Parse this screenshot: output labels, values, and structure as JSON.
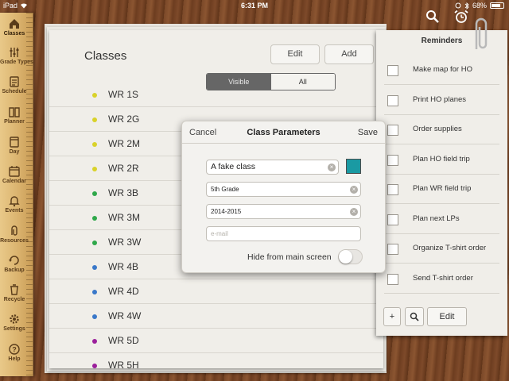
{
  "status_bar": {
    "device": "iPad",
    "time": "6:31 PM",
    "battery": "68%"
  },
  "nav": [
    {
      "label": "Classes",
      "icon": "home-icon"
    },
    {
      "label": "Grade Types",
      "icon": "sliders-icon"
    },
    {
      "label": "Schedule",
      "icon": "schedule-icon"
    },
    {
      "label": "Planner",
      "icon": "book-icon"
    },
    {
      "label": "Day",
      "icon": "day-icon"
    },
    {
      "label": "Calendar",
      "icon": "calendar-icon"
    },
    {
      "label": "Events",
      "icon": "bell-icon"
    },
    {
      "label": "Resources",
      "icon": "paperclip-icon"
    },
    {
      "label": "Backup",
      "icon": "backup-icon"
    },
    {
      "label": "Recycle",
      "icon": "trash-icon"
    },
    {
      "label": "Settings",
      "icon": "gear-icon"
    },
    {
      "label": "Help",
      "icon": "help-icon"
    }
  ],
  "classes_page": {
    "title": "Classes",
    "edit_label": "Edit",
    "add_label": "Add",
    "segment": [
      "Visible",
      "All"
    ],
    "rows": [
      {
        "name": "WR 1S",
        "color": "#d9d22a"
      },
      {
        "name": "WR 2G",
        "color": "#d9d22a"
      },
      {
        "name": "WR 2M",
        "color": "#d9d22a"
      },
      {
        "name": "WR 2R",
        "color": "#d9d22a"
      },
      {
        "name": "WR 3B",
        "color": "#2fa84a"
      },
      {
        "name": "WR 3M",
        "color": "#2fa84a"
      },
      {
        "name": "WR 3W",
        "color": "#2fa84a"
      },
      {
        "name": "WR 4B",
        "color": "#3a78c9"
      },
      {
        "name": "WR 4D",
        "color": "#3a78c9"
      },
      {
        "name": "WR 4W",
        "color": "#3a78c9"
      },
      {
        "name": "WR 5D",
        "color": "#9b1f9b"
      },
      {
        "name": "WR 5H",
        "color": "#9b1f9b"
      }
    ]
  },
  "reminders": {
    "title": "Reminders",
    "items": [
      "Make map for HO",
      "Print HO planes",
      "Order supplies",
      "Plan HO field trip",
      "Plan WR field trip",
      "Plan next LPs",
      "Organize T-shirt order",
      "Send T-shirt order"
    ],
    "footer": {
      "add": "+",
      "search": "search-icon",
      "edit": "Edit"
    }
  },
  "dialog": {
    "cancel": "Cancel",
    "title": "Class Parameters",
    "save": "Save",
    "name_value": "A fake class",
    "grade_value": "5th Grade",
    "year_value": "2014-2015",
    "email_placeholder": "e-mail",
    "color": "#1a9aa3",
    "toggle_label": "Hide from main screen"
  }
}
